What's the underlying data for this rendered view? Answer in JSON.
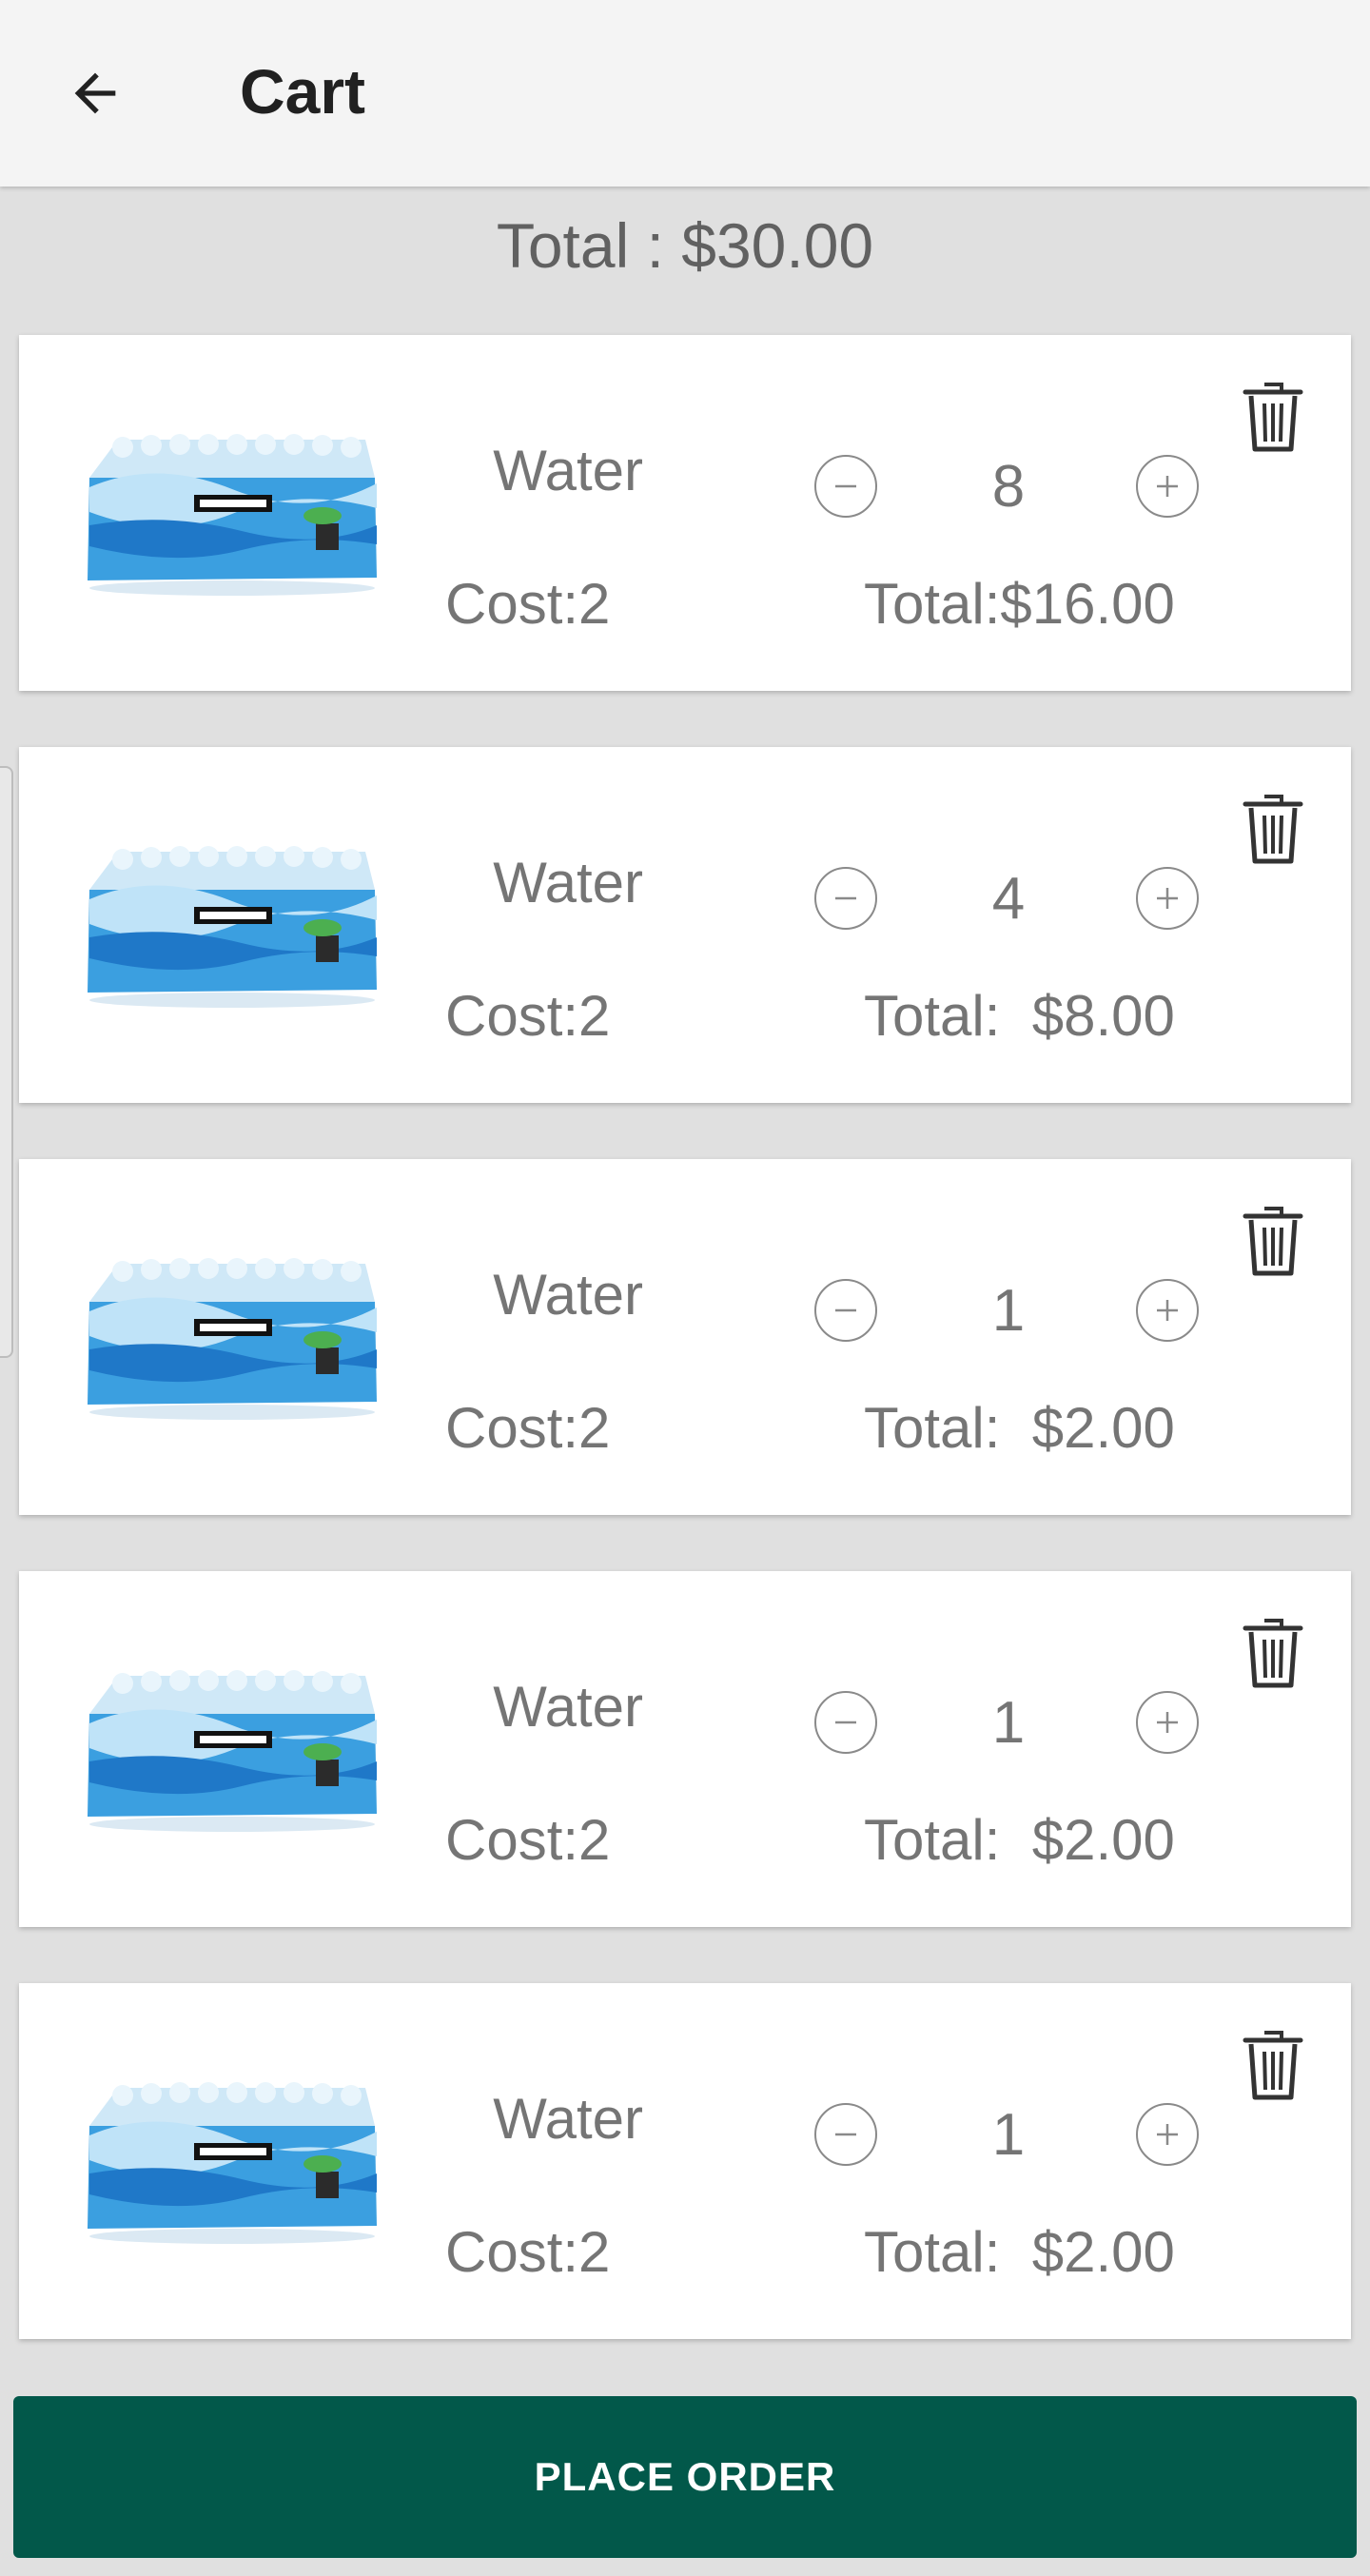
{
  "colors": {
    "background": "#e0e0e0",
    "appbar": "#f4f4f4",
    "card": "#ffffff",
    "text": "#757575",
    "accent": "#02584a"
  },
  "appbar": {
    "back_icon": "arrow-left-icon",
    "title": "Cart"
  },
  "summary": {
    "total_label": "Total : $30.00"
  },
  "items": [
    {
      "name": "Water",
      "cost": "Cost:2",
      "quantity": "8",
      "total": "Total:$16.00"
    },
    {
      "name": "Water",
      "cost": "Cost:2",
      "quantity": "4",
      "total": "Total:  $8.00"
    },
    {
      "name": "Water",
      "cost": "Cost:2",
      "quantity": "1",
      "total": "Total:  $2.00"
    },
    {
      "name": "Water",
      "cost": "Cost:2",
      "quantity": "1",
      "total": "Total:  $2.00"
    },
    {
      "name": "Water",
      "cost": "Cost:2",
      "quantity": "1",
      "total": "Total:  $2.00"
    }
  ],
  "icons": {
    "minus": "minus-circle-icon",
    "plus": "plus-circle-icon",
    "delete": "trash-icon"
  },
  "footer": {
    "place_order_label": "PLACE ORDER"
  }
}
